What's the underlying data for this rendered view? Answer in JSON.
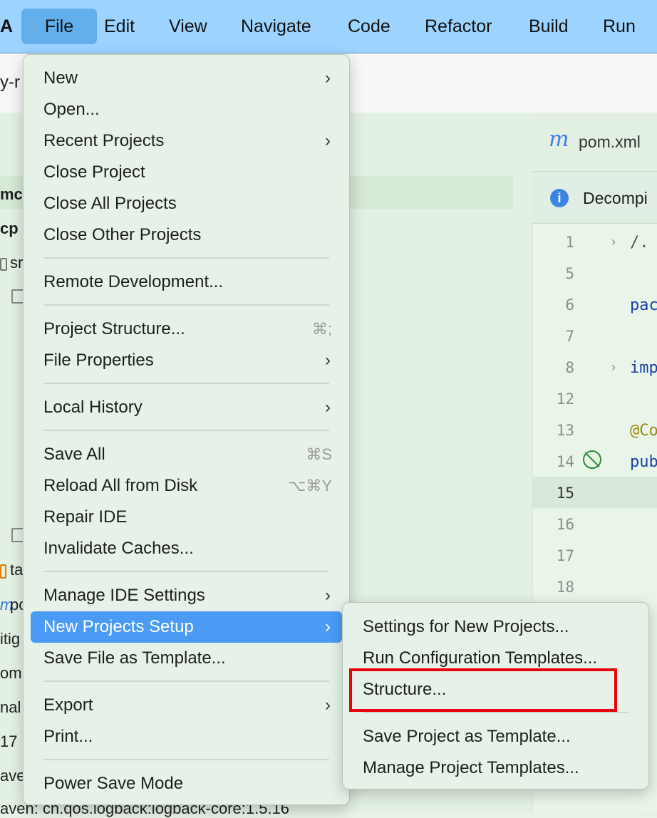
{
  "menubar": {
    "app_fragment": "A",
    "items": [
      "File",
      "Edit",
      "View",
      "Navigate",
      "Code",
      "Refactor",
      "Build",
      "Run"
    ]
  },
  "background": {
    "toolbar_fragment": "y-r",
    "tree": [
      "mcp",
      "cp",
      "sr",
      "ta",
      "po",
      "itig",
      "om",
      "nal",
      "17",
      "ave",
      "aven: ch.qos.logback:logback-core:1.5.16"
    ],
    "editor_tab": "pom.xml",
    "editor_tab_icon": "m",
    "notice": "Decompi",
    "line_numbers": [
      "1",
      "5",
      "6",
      "7",
      "8",
      "12",
      "13",
      "14",
      "15",
      "16",
      "17",
      "18"
    ],
    "code": {
      "l1": "/.",
      "l6": "pac",
      "l8": "imp",
      "l13": "@Co",
      "l14": "pub"
    }
  },
  "file_menu": {
    "items": [
      {
        "label": "New",
        "submenu": true
      },
      {
        "label": "Open..."
      },
      {
        "label": "Recent Projects",
        "submenu": true
      },
      {
        "label": "Close Project"
      },
      {
        "label": "Close All Projects"
      },
      {
        "label": "Close Other Projects"
      },
      {
        "label": "Remote Development..."
      },
      {
        "label": "Project Structure...",
        "shortcut": "⌘;"
      },
      {
        "label": "File Properties",
        "submenu": true
      },
      {
        "label": "Local History",
        "submenu": true
      },
      {
        "label": "Save All",
        "shortcut": "⌘S"
      },
      {
        "label": "Reload All from Disk",
        "shortcut": "⌥⌘Y"
      },
      {
        "label": "Repair IDE"
      },
      {
        "label": "Invalidate Caches..."
      },
      {
        "label": "Manage IDE Settings",
        "submenu": true
      },
      {
        "label": "New Projects Setup",
        "submenu": true,
        "selected": true
      },
      {
        "label": "Save File as Template..."
      },
      {
        "label": "Export",
        "submenu": true
      },
      {
        "label": "Print..."
      },
      {
        "label": "Power Save Mode"
      }
    ]
  },
  "submenu": {
    "items": [
      {
        "label": "Settings for New Projects..."
      },
      {
        "label": "Run Configuration Templates..."
      },
      {
        "label": "Structure...",
        "highlighted": true
      },
      {
        "label": "Save Project as Template..."
      },
      {
        "label": "Manage Project Templates..."
      }
    ]
  },
  "colors": {
    "selection": "#4b9bf6",
    "highlight_box": "#e8000b",
    "menubar": "#9dd3ff"
  }
}
